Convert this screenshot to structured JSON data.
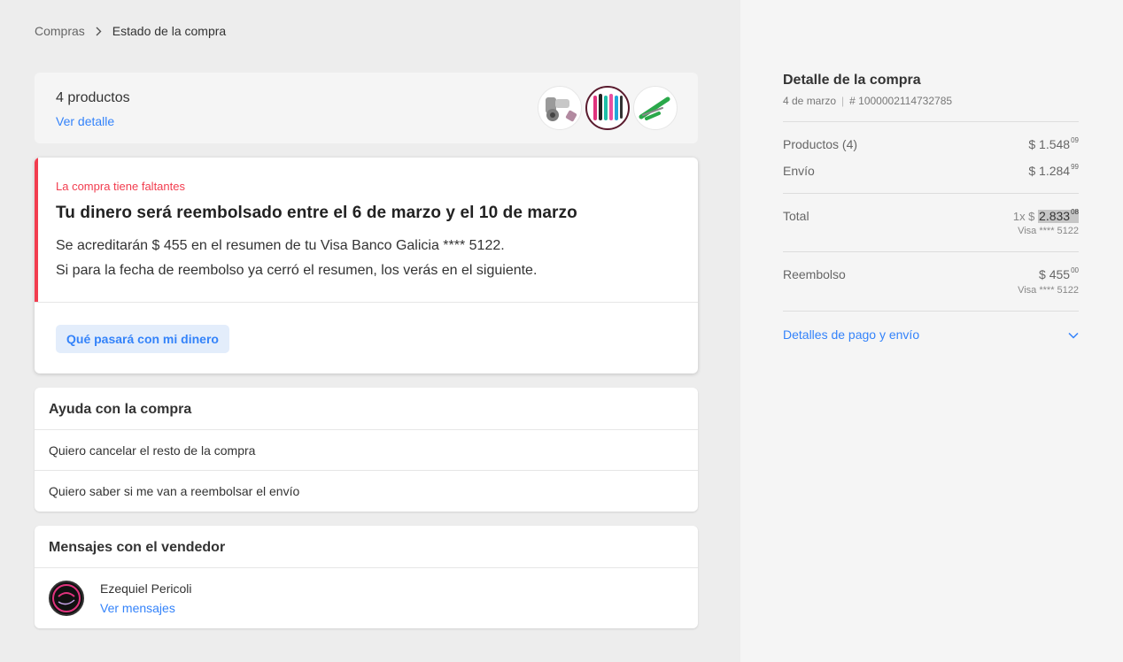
{
  "breadcrumb": {
    "parent": "Compras",
    "current": "Estado de la compra"
  },
  "products": {
    "count_label": "4 productos",
    "detail_link": "Ver detalle",
    "thumbnails": [
      "microscope-thumb",
      "thread-bobbins-thumb",
      "scissors-thumb"
    ]
  },
  "refund": {
    "status": "La compra tiene faltantes",
    "title": "Tu dinero será reembolsado entre el 6 de marzo y el 10 de marzo",
    "line1": "Se acreditarán $ 455 en el resumen de tu Visa Banco Galicia **** 5122.",
    "line2": "Si para la fecha de reembolso ya cerró el resumen, los verás en el siguiente.",
    "button": "Qué pasará con mi dinero"
  },
  "help": {
    "heading": "Ayuda con la compra",
    "items": [
      "Quiero cancelar el resto de la compra",
      "Quiero saber si me van a reembolsar el envío"
    ]
  },
  "messages": {
    "heading": "Mensajes con el vendedor",
    "seller_name": "Ezequiel Pericoli",
    "link": "Ver mensajes"
  },
  "detail": {
    "title": "Detalle de la compra",
    "date": "4 de marzo",
    "order_number": "# 1000002114732785",
    "products_label": "Productos (4)",
    "products_amount": "$ 1.548",
    "products_cents": "09",
    "shipping_label": "Envío",
    "shipping_amount": "$ 1.284",
    "shipping_cents": "99",
    "total_label": "Total",
    "total_prefix": "1x $",
    "total_amount": "2.833",
    "total_cents": "08",
    "total_card": "Visa **** 5122",
    "refund_label": "Reembolso",
    "refund_amount": "$ 455",
    "refund_cents": "00",
    "refund_card": "Visa **** 5122",
    "payment_link": "Detalles de pago y envío"
  },
  "colors": {
    "accent": "#3483fa",
    "warning": "#f23d4f"
  }
}
